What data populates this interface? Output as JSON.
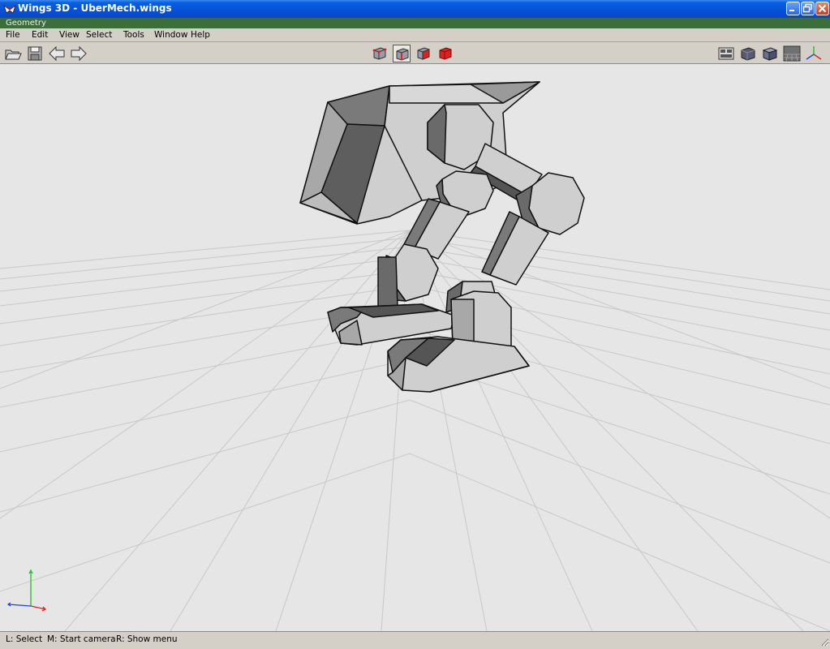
{
  "window": {
    "title": "Wings 3D - UberMech.wings",
    "icon": "wings-logo-icon",
    "controls": [
      "minimize-icon",
      "restore-icon",
      "close-icon"
    ]
  },
  "geometry_header": {
    "label": "Geometry"
  },
  "menubar": {
    "items": [
      "File",
      "Edit",
      "View",
      "Select",
      "Tools",
      "Window",
      "Help"
    ]
  },
  "toolbar": {
    "left": [
      "open-folder-icon",
      "save-icon",
      "undo-arrow-icon",
      "redo-arrow-icon"
    ],
    "selection_modes": [
      "vertex-mode-icon",
      "edge-mode-icon",
      "face-mode-icon",
      "body-mode-icon"
    ],
    "active_selection_mode": "edge-mode-icon",
    "right": [
      "toggle-wireframe-icon",
      "smooth-shaded-icon",
      "flat-shaded-icon",
      "ground-plane-icon",
      "axes-icon"
    ]
  },
  "viewport": {
    "model": "UberMech",
    "ground_grid": true,
    "axis_indicator": {
      "x": "#e02020",
      "y": "#20c020",
      "z": "#2040e0"
    }
  },
  "statusbar": {
    "hints": [
      "L: Select",
      "M: Start camera",
      "R: Show menu"
    ]
  },
  "colors": {
    "titlebar": "#0551d8",
    "geometry_header": "#3c6e3c",
    "viewport_bg": "#e6e6e6",
    "grid_line": "#c8c8c8",
    "mesh_light": "#cfcfcf",
    "mesh_mid": "#a8a8a8",
    "mesh_dark": "#6a6a6a",
    "face_mode_red": "#e02020"
  }
}
